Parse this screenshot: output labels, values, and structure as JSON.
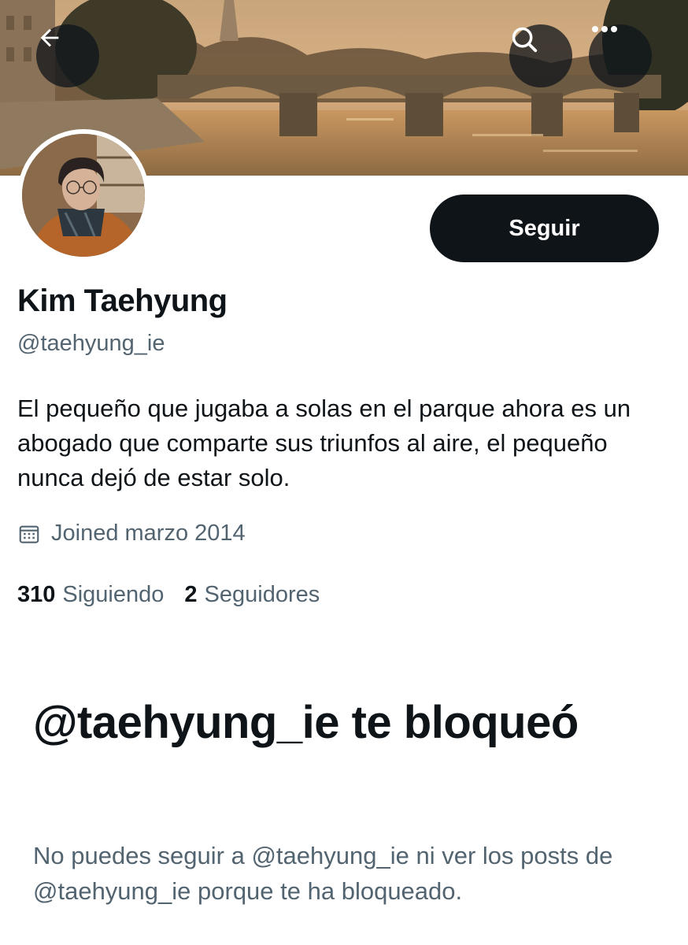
{
  "header": {
    "back_icon": "arrow-left-icon",
    "search_icon": "search-icon",
    "more_icon": "more-horizontal-icon"
  },
  "profile": {
    "display_name": "Kim Taehyung",
    "handle": "@taehyung_ie",
    "bio": "El pequeño que jugaba a solas en el parque ahora es un abogado que comparte sus triunfos al aire, el pequeño nunca dejó de estar solo.",
    "joined_icon": "calendar-icon",
    "joined": "Joined marzo 2014",
    "follow_label": "Seguir",
    "stats": {
      "following_count": "310",
      "following_label": "Siguiendo",
      "followers_count": "2",
      "followers_label": "Seguidores"
    }
  },
  "blocked": {
    "title": "@taehyung_ie te bloqueó",
    "description": "No puedes seguir a @taehyung_ie ni ver los posts de @taehyung_ie porque te ha bloqueado."
  },
  "colors": {
    "primary_text": "#0f1419",
    "secondary_text": "#536471",
    "button_bg": "#0f1419",
    "button_text": "#ffffff"
  }
}
